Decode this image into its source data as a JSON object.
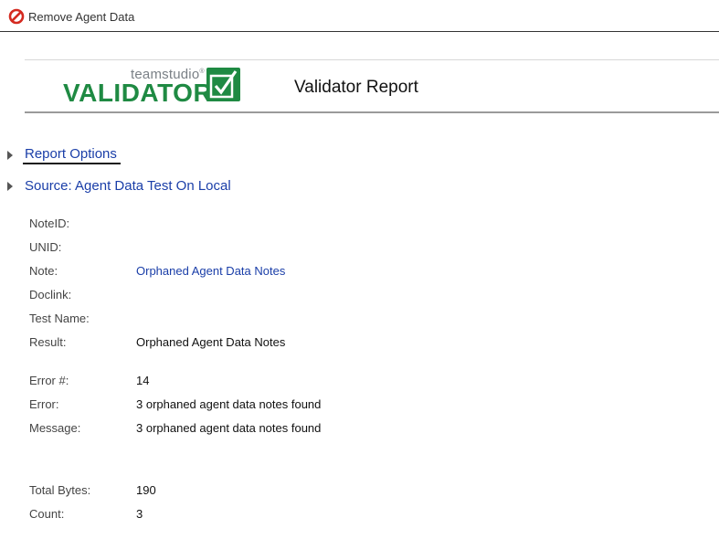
{
  "toolbar": {
    "remove_label": "Remove Agent Data",
    "remove_icon": "prohibited-icon"
  },
  "banner": {
    "logo_small": "teamstudio",
    "logo_reg": "®",
    "logo_big": "VALIDATOR",
    "logo_icon": "checkmark-box-icon",
    "title": "Validator Report"
  },
  "sections": {
    "report_options": "Report Options",
    "source": "Source: Agent Data Test On Local"
  },
  "fields": {
    "noteid": {
      "label": "NoteID:",
      "value": ""
    },
    "unid": {
      "label": "UNID:",
      "value": ""
    },
    "note": {
      "label": "Note:",
      "value": "Orphaned Agent Data Notes"
    },
    "doclink": {
      "label": "Doclink:",
      "value": ""
    },
    "test_name": {
      "label": "Test Name:",
      "value": ""
    },
    "result": {
      "label": "Result:",
      "value": "Orphaned Agent Data Notes"
    },
    "error_num": {
      "label": "Error #:",
      "value": "14"
    },
    "error": {
      "label": "Error:",
      "value": "3 orphaned agent data notes found"
    },
    "message": {
      "label": "Message:",
      "value": "3 orphaned agent data notes found"
    },
    "total_bytes": {
      "label": "Total Bytes:",
      "value": "190"
    },
    "count": {
      "label": "Count:",
      "value": "3"
    }
  },
  "colors": {
    "link": "#1a3ea8",
    "logo_green": "#1f8a43",
    "prohibited_red": "#d42a20"
  }
}
